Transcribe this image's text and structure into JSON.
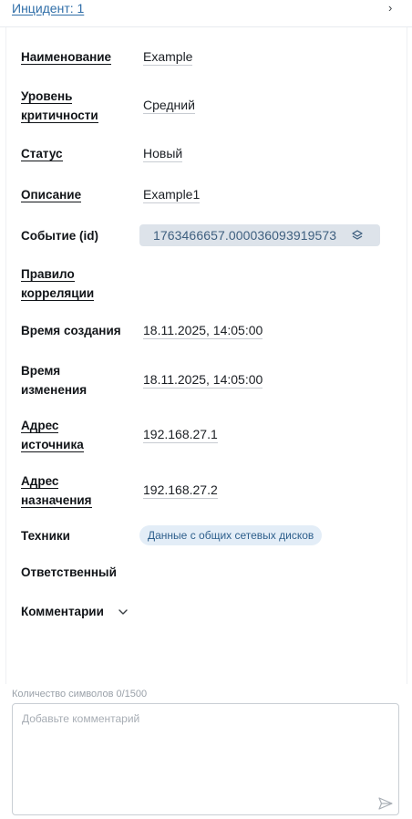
{
  "header": {
    "breadcrumb": "Инцидент: 1",
    "chevron": "›"
  },
  "fields": {
    "name": {
      "label": "Наименование",
      "value": "Example"
    },
    "severity": {
      "label_l1": "Уровень",
      "label_l2": "критичности",
      "value": "Средний"
    },
    "status": {
      "label": "Статус",
      "value": "Новый"
    },
    "description": {
      "label": "Описание",
      "value": "Example1"
    },
    "event": {
      "label": "Событие (id)",
      "value": "1763466657.000036093919573",
      "icon": "layers-icon"
    },
    "correlation_rule": {
      "label_l1": "Правило",
      "label_l2": "корреляции"
    },
    "created": {
      "label": "Время создания",
      "value": "18.11.2025, 14:05:00"
    },
    "modified": {
      "label_l1": "Время",
      "label_l2": "изменения",
      "value": "18.11.2025, 14:05:00"
    },
    "source_address": {
      "label_l1": "Адрес",
      "label_l2": "источника",
      "value": "192.168.27.1"
    },
    "destination_address": {
      "label_l1": "Адрес",
      "label_l2": "назначения",
      "value": "192.168.27.2"
    },
    "techniques": {
      "label": "Техники",
      "chip": "Данные с общих сетевых дисков"
    },
    "assignee": {
      "label": "Ответственный"
    }
  },
  "comments": {
    "label": "Комментарии",
    "counter": "Количество символов 0/1500",
    "placeholder": "Добавьте комментарий",
    "send_icon": "send-icon"
  },
  "colors": {
    "link": "#2f6ea8",
    "event_chip_bg": "#dde3ea",
    "event_chip_text": "#3e5f7f",
    "tech_chip_bg": "#e3edf7",
    "tech_chip_text": "#2e5f8c"
  }
}
